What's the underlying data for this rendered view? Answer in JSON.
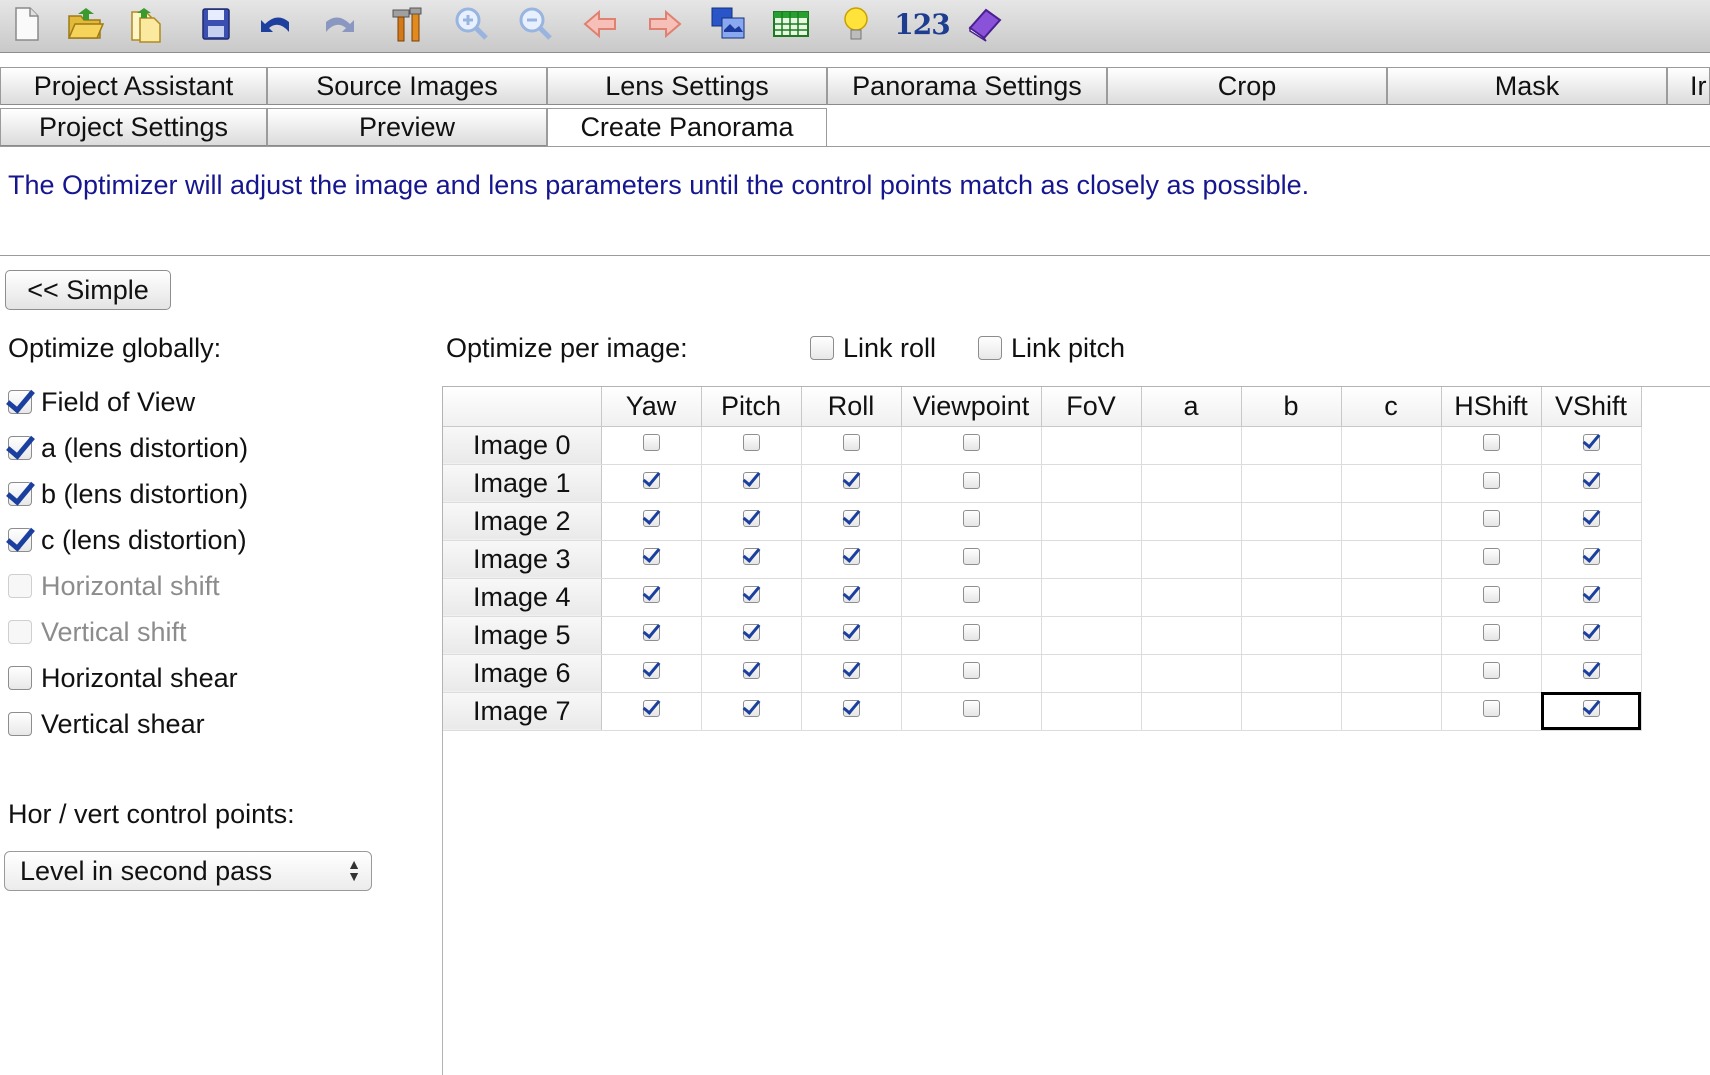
{
  "toolbar": {
    "buttons": [
      {
        "icon": "new-project-icon"
      },
      {
        "icon": "open-project-icon"
      },
      {
        "icon": "add-images-icon"
      },
      {
        "icon": "save-icon"
      },
      {
        "icon": "undo-icon"
      },
      {
        "icon": "redo-icon"
      },
      {
        "icon": "tools-icon"
      },
      {
        "icon": "zoom-in-icon"
      },
      {
        "icon": "zoom-out-icon"
      },
      {
        "icon": "arrow-left-icon"
      },
      {
        "icon": "arrow-right-icon"
      },
      {
        "icon": "preview-window-icon"
      },
      {
        "icon": "table-icon"
      },
      {
        "icon": "lightbulb-icon"
      },
      {
        "icon": "numbers-icon",
        "text": "123"
      },
      {
        "icon": "help-book-icon"
      }
    ]
  },
  "tabs": {
    "row1": [
      "Project Assistant",
      "Source Images",
      "Lens Settings",
      "Panorama Settings",
      "Crop",
      "Mask",
      "Ir"
    ],
    "row2": [
      "Project Settings",
      "Preview",
      "Create Panorama"
    ],
    "active": "Create Panorama"
  },
  "description": "The Optimizer will adjust the image and lens parameters until the control points match as closely as possible.",
  "simple_button": "<< Simple",
  "global": {
    "title": "Optimize globally:",
    "options": [
      {
        "label": "Field of View",
        "checked": true,
        "enabled": true
      },
      {
        "label": "a (lens distortion)",
        "checked": true,
        "enabled": true
      },
      {
        "label": "b (lens distortion)",
        "checked": true,
        "enabled": true
      },
      {
        "label": "c (lens distortion)",
        "checked": true,
        "enabled": true
      },
      {
        "label": "Horizontal shift",
        "checked": false,
        "enabled": false
      },
      {
        "label": "Vertical shift",
        "checked": false,
        "enabled": false
      },
      {
        "label": "Horizontal shear",
        "checked": false,
        "enabled": true
      },
      {
        "label": "Vertical shear",
        "checked": false,
        "enabled": true
      }
    ]
  },
  "control_points": {
    "label": "Hor / vert control points:",
    "selected": "Level in second pass"
  },
  "per_image": {
    "title": "Optimize per image:",
    "link_roll": {
      "label": "Link roll",
      "checked": false
    },
    "link_pitch": {
      "label": "Link pitch",
      "checked": false
    },
    "columns": [
      "Yaw",
      "Pitch",
      "Roll",
      "Viewpoint",
      "FoV",
      "a",
      "b",
      "c",
      "HShift",
      "VShift"
    ],
    "rows": [
      {
        "label": "Image 0",
        "cells": [
          false,
          false,
          false,
          false,
          null,
          null,
          null,
          null,
          false,
          true
        ]
      },
      {
        "label": "Image 1",
        "cells": [
          true,
          true,
          true,
          false,
          null,
          null,
          null,
          null,
          false,
          true
        ]
      },
      {
        "label": "Image 2",
        "cells": [
          true,
          true,
          true,
          false,
          null,
          null,
          null,
          null,
          false,
          true
        ]
      },
      {
        "label": "Image 3",
        "cells": [
          true,
          true,
          true,
          false,
          null,
          null,
          null,
          null,
          false,
          true
        ]
      },
      {
        "label": "Image 4",
        "cells": [
          true,
          true,
          true,
          false,
          null,
          null,
          null,
          null,
          false,
          true
        ]
      },
      {
        "label": "Image 5",
        "cells": [
          true,
          true,
          true,
          false,
          null,
          null,
          null,
          null,
          false,
          true
        ]
      },
      {
        "label": "Image 6",
        "cells": [
          true,
          true,
          true,
          false,
          null,
          null,
          null,
          null,
          false,
          true
        ]
      },
      {
        "label": "Image 7",
        "cells": [
          true,
          true,
          true,
          false,
          null,
          null,
          null,
          null,
          false,
          true
        ]
      }
    ],
    "focused_cell": {
      "row": 7,
      "col": 9
    }
  },
  "colors": {
    "description_text": "#16168f",
    "check_mark": "#1a3f9e",
    "disabled_text": "#8c8c8c"
  }
}
